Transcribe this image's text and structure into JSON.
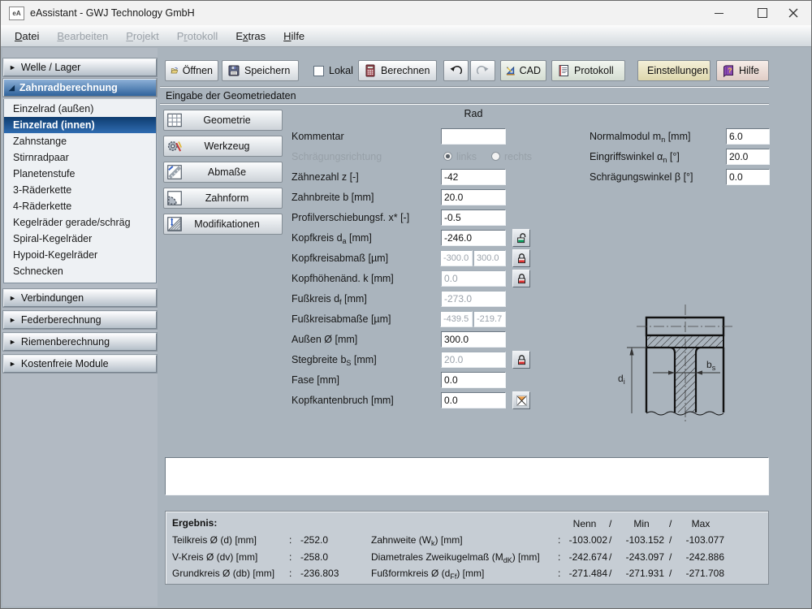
{
  "window": {
    "title": "eAssistant - GWJ Technology GmbH",
    "logo": "eA"
  },
  "menu": {
    "items": [
      {
        "pre": "",
        "key": "D",
        "post": "atei",
        "enabled": true
      },
      {
        "pre": "",
        "key": "B",
        "post": "earbeiten",
        "enabled": false
      },
      {
        "pre": "",
        "key": "P",
        "post": "rojekt",
        "enabled": false
      },
      {
        "pre": "P",
        "key": "r",
        "post": "otokoll",
        "enabled": false
      },
      {
        "pre": "E",
        "key": "x",
        "post": "tras",
        "enabled": true
      },
      {
        "pre": "",
        "key": "H",
        "post": "ilfe",
        "enabled": true
      }
    ]
  },
  "toolbar": {
    "open": "Öffnen",
    "save": "Speichern",
    "local": "Lokal",
    "calculate": "Berechnen",
    "cad": "CAD",
    "protocol": "Protokoll",
    "settings": "Einstellungen",
    "help": "Hilfe"
  },
  "sidebar": {
    "sections": [
      "Welle / Lager",
      "Zahnradberechnung",
      "Verbindungen",
      "Federberechnung",
      "Riemenberechnung",
      "Kostenfreie Module"
    ],
    "items": [
      "Einzelrad (außen)",
      "Einzelrad (innen)",
      "Zahnstange",
      "Stirnradpaar",
      "Planetenstufe",
      "3-Räderkette",
      "4-Räderkette",
      "Kegelräder gerade/schräg",
      "Spiral-Kegelräder",
      "Hypoid-Kegelräder",
      "Schnecken"
    ]
  },
  "content": {
    "header": "Eingabe der Geometriedaten",
    "col_header": "Rad",
    "nav_buttons": [
      "Geometrie",
      "Werkzeug",
      "Abmaße",
      "Zahnform",
      "Modifikationen"
    ],
    "form": {
      "kommentar": {
        "label": "Kommentar",
        "value": ""
      },
      "schraegung": {
        "label": "Schrägungsrichtung",
        "opt1": "links",
        "opt2": "rechts"
      },
      "zaehnezahl": {
        "label": "Zähnezahl z [-]",
        "value": "-42"
      },
      "zahnbreite": {
        "label": "Zahnbreite b [mm]",
        "value": "20.0"
      },
      "profilverschiebung": {
        "label": "Profilverschiebungsf. x* [-]",
        "value": "-0.5"
      },
      "kopfkreis": {
        "l1": "Kopfkreis d",
        "sub": "a",
        "l2": " [mm]",
        "value": "-246.0"
      },
      "kopfkreisabmass": {
        "label": "Kopfkreisabmaß [µm]",
        "value1": "-300.0",
        "value2": "300.0"
      },
      "kopfhoehenaend": {
        "label": "Kopfhöhenänd. k [mm]",
        "value": "0.0"
      },
      "fusskreis": {
        "l1": "Fußkreis d",
        "sub": "f",
        "l2": " [mm]",
        "value": "-273.0"
      },
      "fusskreisabmasse": {
        "label": "Fußkreisabmaße [µm]",
        "value1": "-439.5",
        "value2": "-219.7"
      },
      "aussen": {
        "label": "Außen Ø [mm]",
        "value": "300.0"
      },
      "stegbreite": {
        "l1": "Stegbreite b",
        "sub": "S",
        "l2": " [mm]",
        "value": "20.0"
      },
      "fase": {
        "label": "Fase [mm]",
        "value": "0.0"
      },
      "kopfkantenbruch": {
        "label": "Kopfkantenbruch [mm]",
        "value": "0.0"
      },
      "normalmodul": {
        "l1": "Normalmodul m",
        "sub": "n",
        "l2": " [mm]",
        "value": "6.0"
      },
      "eingriffswinkel": {
        "l1": "Eingriffswinkel α",
        "sub": "n",
        "l2": " [°]",
        "value": "20.0"
      },
      "schraegungswinkel": {
        "label": "Schrägungswinkel β [°]",
        "value": "0.0"
      }
    },
    "drawing": {
      "d_label": "d",
      "d_sub": "i",
      "b_label": "b",
      "b_sub": "s"
    },
    "results": {
      "title": "Ergebnis:",
      "colon": ":",
      "slash": "/",
      "col_nenn": "Nenn",
      "col_min": "Min",
      "col_max": "Max",
      "left": [
        {
          "label": "Teilkreis Ø (d) [mm]",
          "value": "-252.0"
        },
        {
          "label": "V-Kreis Ø (dv) [mm]",
          "value": "-258.0"
        },
        {
          "label": "Grundkreis Ø (db) [mm]",
          "value": "-236.803"
        }
      ],
      "right": [
        {
          "l1": "Zahnweite (W",
          "sub": "k",
          "l2": ") [mm]",
          "nenn": "-103.002",
          "min": "-103.152",
          "max": "-103.077"
        },
        {
          "l1": "Diametrales Zweikugelmaß (M",
          "sub": "dK",
          "l2": ") [mm]",
          "nenn": "-242.674",
          "min": "-243.097",
          "max": "-242.886"
        },
        {
          "l1": "Fußformkreis Ø (d",
          "sub": "Ff",
          "l2": ") [mm]",
          "nenn": "-271.484",
          "min": "-271.931",
          "max": "-271.708"
        }
      ]
    }
  },
  "colors": {
    "accent_blue": "#2f639c",
    "selected_blue": "#0e3c6f",
    "lock_open": "#0aa060",
    "lock_closed": "#dd3333",
    "chamfer_orange": "#f0a04a"
  }
}
